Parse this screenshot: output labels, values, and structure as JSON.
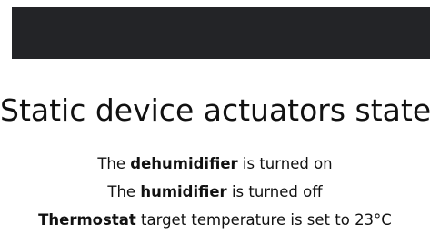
{
  "header": {
    "title": "Static device actuators state:"
  },
  "actuators": [
    {
      "prefix": "The ",
      "name": "dehumidifier",
      "suffix": " is turned on"
    },
    {
      "prefix": "The ",
      "name": "humidifier",
      "suffix": " is turned off"
    },
    {
      "prefix": "",
      "name": "Thermostat",
      "suffix": " target temperature is set to 23°C"
    }
  ],
  "colors": {
    "topbar": "#232427",
    "background": "#ffffff",
    "text": "#111111"
  }
}
